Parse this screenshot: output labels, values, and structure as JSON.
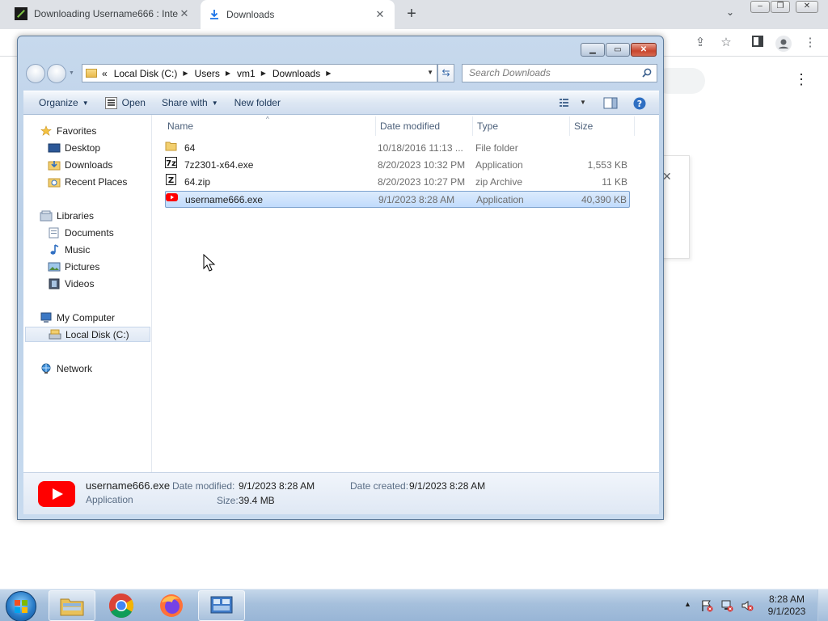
{
  "browser": {
    "tabs": [
      {
        "title": "Downloading Username666 : Inte",
        "active": false
      },
      {
        "title": "Downloads",
        "active": true
      }
    ],
    "new_tab_symbol": "+",
    "tab_close_symbol": "✕"
  },
  "window": {
    "address": {
      "overflow": "«",
      "crumbs": [
        "Local Disk (C:)",
        "Users",
        "vm1",
        "Downloads"
      ]
    },
    "search_placeholder": "Search Downloads",
    "commands": {
      "organize": "Organize",
      "open": "Open",
      "share_with": "Share with",
      "new_folder": "New folder"
    },
    "nav_pane": {
      "favorites": "Favorites",
      "desktop": "Desktop",
      "downloads": "Downloads",
      "recent_places": "Recent Places",
      "libraries": "Libraries",
      "documents": "Documents",
      "music": "Music",
      "pictures": "Pictures",
      "videos": "Videos",
      "my_computer": "My Computer",
      "local_disk": "Local Disk (C:)",
      "network": "Network"
    },
    "columns": {
      "name": "Name",
      "date_modified": "Date modified",
      "type": "Type",
      "size": "Size"
    },
    "files": [
      {
        "name": "64",
        "date": "10/18/2016 11:13 ...",
        "type": "File folder",
        "size": "",
        "icon": "folder-icon",
        "selected": false
      },
      {
        "name": "7z2301-x64.exe",
        "date": "8/20/2023 10:32 PM",
        "type": "Application",
        "size": "1,553 KB",
        "icon": "7zip-icon",
        "selected": false
      },
      {
        "name": "64.zip",
        "date": "8/20/2023 10:27 PM",
        "type": "zip Archive",
        "size": "11 KB",
        "icon": "zip-archive-icon",
        "selected": false
      },
      {
        "name": "username666.exe",
        "date": "9/1/2023 8:28 AM",
        "type": "Application",
        "size": "40,390 KB",
        "icon": "youtube-icon",
        "selected": true
      }
    ],
    "details": {
      "filename": "username666.exe",
      "filetype": "Application",
      "date_modified_label": "Date modified:",
      "date_modified": "9/1/2023 8:28 AM",
      "date_created_label": "Date created:",
      "date_created": "9/1/2023 8:28 AM",
      "size_label": "Size:",
      "size": "39.4 MB"
    }
  },
  "taskbar": {
    "clock_time": "8:28 AM",
    "clock_date": "9/1/2023"
  },
  "colors": {
    "selection": "#c1dbfc",
    "youtube_red": "#ff0000",
    "chrome_tabbar": "#dee1e6"
  }
}
